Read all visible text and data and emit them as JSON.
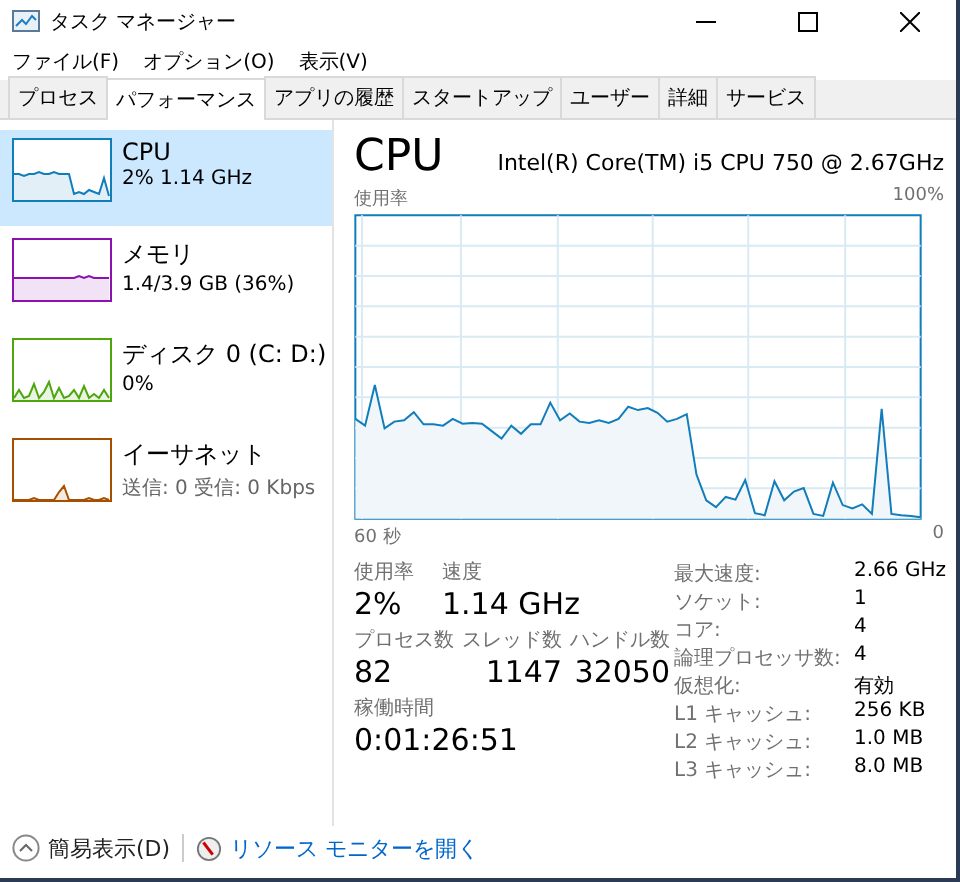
{
  "window": {
    "title": "タスク マネージャー"
  },
  "menu": [
    "ファイル(F)",
    "オプション(O)",
    "表示(V)"
  ],
  "tabs": [
    {
      "label": "プロセス",
      "selected": false
    },
    {
      "label": "パフォーマンス",
      "selected": true
    },
    {
      "label": "アプリの履歴",
      "selected": false
    },
    {
      "label": "スタートアップ",
      "selected": false
    },
    {
      "label": "ユーザー",
      "selected": false
    },
    {
      "label": "詳細",
      "selected": false
    },
    {
      "label": "サービス",
      "selected": false
    }
  ],
  "sidebar": {
    "items": [
      {
        "kind": "cpu",
        "name": "CPU",
        "detail": "2%  1.14 GHz",
        "selected": true,
        "color": "#117dbb"
      },
      {
        "kind": "memory",
        "name": "メモリ",
        "detail": "1.4/3.9 GB (36%)",
        "selected": false,
        "color": "#8b12ae"
      },
      {
        "kind": "disk",
        "name": "ディスク 0 (C: D:)",
        "detail": "0%",
        "selected": false,
        "color": "#4da60c"
      },
      {
        "kind": "network",
        "name": "イーサネット",
        "detail": "送信: 0 受信: 0 Kbps",
        "selected": false,
        "color": "#a74f01"
      }
    ]
  },
  "main": {
    "title": "CPU",
    "model": "Intel(R) Core(TM) i5 CPU 750 @ 2.67GHz",
    "graph": {
      "y_label": "使用率",
      "y_max": "100%",
      "x_start": "60 秒",
      "x_end": "0"
    },
    "primary_stats": [
      {
        "label": "使用率",
        "value": "2%"
      },
      {
        "label": "速度",
        "value": "1.14 GHz"
      }
    ],
    "counts": [
      {
        "label": "プロセス数",
        "value": "82"
      },
      {
        "label": "スレッド数",
        "value": "1147"
      },
      {
        "label": "ハンドル数",
        "value": "32050"
      }
    ],
    "uptime": {
      "label": "稼働時間",
      "value": "0:01:26:51"
    },
    "specs": [
      {
        "label": "最大速度:",
        "value": "2.66 GHz"
      },
      {
        "label": "ソケット:",
        "value": "1"
      },
      {
        "label": "コア:",
        "value": "4"
      },
      {
        "label": "論理プロセッサ数:",
        "value": "4"
      },
      {
        "label": "仮想化:",
        "value": "有効"
      },
      {
        "label": "L1 キャッシュ:",
        "value": "256 KB"
      },
      {
        "label": "L2 キャッシュ:",
        "value": "1.0 MB"
      },
      {
        "label": "L3 キャッシュ:",
        "value": "8.0 MB"
      }
    ]
  },
  "footer": {
    "fewer_details": "簡易表示(D)",
    "resource_monitor": "リソース モニターを開く"
  }
}
